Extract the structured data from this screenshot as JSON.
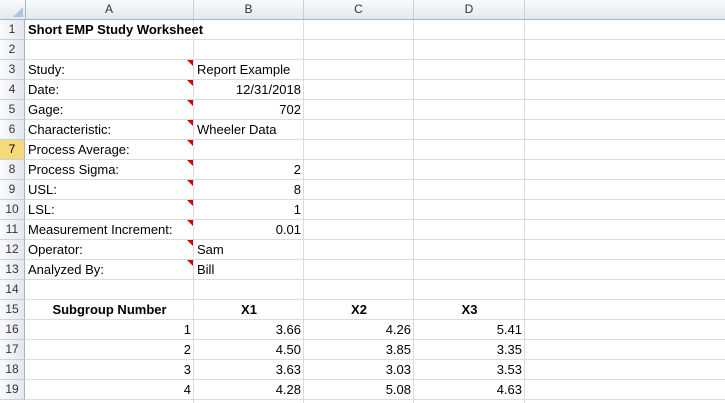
{
  "columns": [
    "A",
    "B",
    "C",
    "D"
  ],
  "rows": [
    "1",
    "2",
    "3",
    "4",
    "5",
    "6",
    "7",
    "8",
    "9",
    "10",
    "11",
    "12",
    "13",
    "14",
    "15",
    "16",
    "17",
    "18",
    "19"
  ],
  "selected_row": "7",
  "sheet": {
    "title": "Short EMP Study Worksheet",
    "fields": [
      {
        "label": "Study:",
        "value": "Report Example"
      },
      {
        "label": "Date:",
        "value": "12/31/2018"
      },
      {
        "label": "Gage:",
        "value": "702"
      },
      {
        "label": "Characteristic:",
        "value": "Wheeler Data"
      },
      {
        "label": "Process Average:",
        "value": ""
      },
      {
        "label": "Process Sigma:",
        "value": "2"
      },
      {
        "label": "USL:",
        "value": "8"
      },
      {
        "label": "LSL:",
        "value": "1"
      },
      {
        "label": "Measurement Increment:",
        "value": "0.01"
      },
      {
        "label": "Operator:",
        "value": "Sam"
      },
      {
        "label": "Analyzed By:",
        "value": "Bill"
      }
    ],
    "table": {
      "headers": [
        "Subgroup Number",
        "X1",
        "X2",
        "X3"
      ],
      "rows": [
        [
          "1",
          "3.66",
          "4.26",
          "5.41"
        ],
        [
          "2",
          "4.50",
          "3.85",
          "3.35"
        ],
        [
          "3",
          "3.63",
          "3.03",
          "3.53"
        ],
        [
          "4",
          "4.28",
          "5.08",
          "4.63"
        ]
      ]
    }
  },
  "colors": {
    "comment_marker": "#d00000",
    "selected_row_header": "#f8d97a"
  }
}
